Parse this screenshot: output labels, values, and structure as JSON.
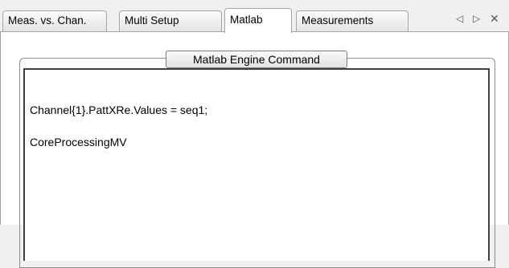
{
  "tabs": [
    {
      "label": "Meas. vs. Chan.",
      "active": false
    },
    {
      "label": "Multi Setup",
      "active": false
    },
    {
      "label": "Matlab",
      "active": true
    },
    {
      "label": "Measurements",
      "active": false
    }
  ],
  "tab_controls": {
    "prev_icon": "◁",
    "next_icon": "▷",
    "close_icon": "✕"
  },
  "group": {
    "title": "Matlab Engine Command"
  },
  "command": {
    "lines": [
      "Channel{1}.PattXRe.Values = seq1;",
      "CoreProcessingMV"
    ]
  },
  "colors": {
    "background": "#f0f0f0",
    "panel": "#ffffff",
    "tab_border": "#a5a5a5"
  }
}
